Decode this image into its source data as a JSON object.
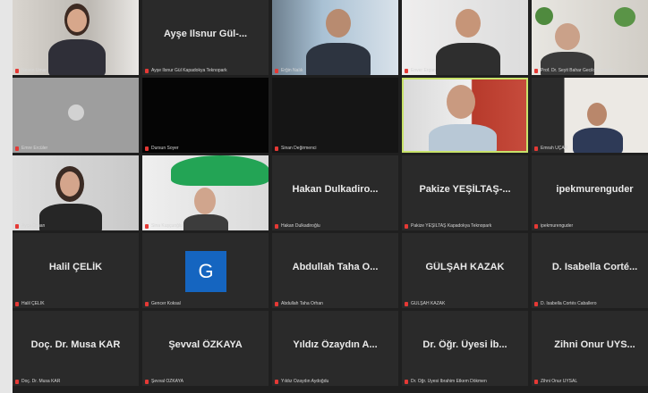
{
  "participants": [
    {
      "id": "p1",
      "caption": "Nesrin Umar",
      "center": "",
      "video": true
    },
    {
      "id": "p2",
      "caption": "Ayşe Ilsnur Gül Kapadokya Teknopark",
      "center": "Ayşe Ilsnur Gül-...",
      "video": false
    },
    {
      "id": "p3",
      "caption": "Erğin Nalık",
      "center": "",
      "video": true
    },
    {
      "id": "p4",
      "caption": "Enver Ergan",
      "center": "",
      "video": true
    },
    {
      "id": "p5",
      "caption": "Prof. Dr. Seyit Bahar Gecilosmanoğlu",
      "center": "",
      "video": true
    },
    {
      "id": "p6",
      "caption": "Emre Ercüler",
      "center": "",
      "video": true
    },
    {
      "id": "p7",
      "caption": "Dursun Soyer",
      "center": "",
      "video": true
    },
    {
      "id": "p8",
      "caption": "Sinan Değirmenci",
      "center": "",
      "video": true
    },
    {
      "id": "p9",
      "caption": "",
      "center": "",
      "video": true
    },
    {
      "id": "p10",
      "caption": "Emrah UÇAR",
      "center": "",
      "video": true
    },
    {
      "id": "p11",
      "caption": "Ayça Orhan",
      "center": "",
      "video": true
    },
    {
      "id": "p12",
      "caption": "Sina Kuşçuoğlu",
      "center": "",
      "video": true
    },
    {
      "id": "p13",
      "caption": "Hakan Dulkadiroğlu",
      "center": "Hakan Dulkadiro...",
      "video": false
    },
    {
      "id": "p14",
      "caption": "Pakize YEŞİLTAŞ Kapadokya Teknopark",
      "center": "Pakize YEŞİLTAŞ-...",
      "video": false
    },
    {
      "id": "p15",
      "caption": "ipekmurenguder",
      "center": "ipekmurenguder",
      "video": false
    },
    {
      "id": "p16",
      "caption": "Halil ÇELİK",
      "center": "Halil ÇELİK",
      "video": false
    },
    {
      "id": "p17",
      "caption": "Gencer Koksal",
      "center": "",
      "video": false,
      "avatar": "G"
    },
    {
      "id": "p18",
      "caption": "Abdullah Taha Orhan",
      "center": "Abdullah Taha O...",
      "video": false
    },
    {
      "id": "p19",
      "caption": "GÜLŞAH KAZAK",
      "center": "GÜLŞAH KAZAK",
      "video": false
    },
    {
      "id": "p20",
      "caption": "D. Isabella Cortés Caballero",
      "center": "D. Isabella Corté...",
      "video": false
    },
    {
      "id": "p21",
      "caption": "Doç. Dr. Musa KAR",
      "center": "Doç. Dr. Musa KAR",
      "video": false
    },
    {
      "id": "p22",
      "caption": "Şevval ÖZKAYA",
      "center": "Şevval ÖZKAYA",
      "video": false
    },
    {
      "id": "p23",
      "caption": "Yıldız Özaydın Aydoğdu",
      "center": "Yıldız Özaydın A...",
      "video": false
    },
    {
      "id": "p24",
      "caption": "Dr. Öğr. Üyesi İbrahim Etkem Dökmen",
      "center": "Dr. Öğr. Üyesi İb...",
      "video": false
    },
    {
      "id": "p25",
      "caption": "Zihni Onur UYSAL",
      "center": "Zihni Onur UYS...",
      "video": false
    }
  ],
  "colors": {
    "active_border": "#c8e26a",
    "tile": "#2a2a2a",
    "mic_muted": "#e53935",
    "avatar_bg": "#1565c0"
  }
}
